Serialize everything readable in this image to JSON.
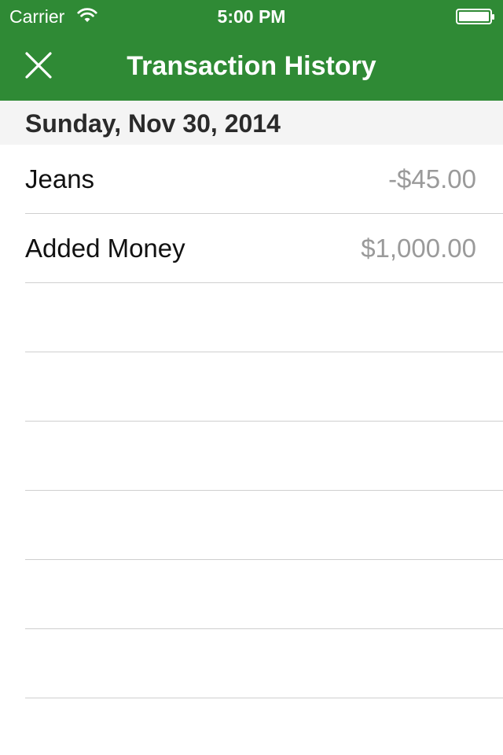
{
  "status_bar": {
    "carrier": "Carrier",
    "time": "5:00 PM",
    "wifi_icon": "wifi-icon",
    "battery_icon": "battery-icon"
  },
  "nav": {
    "title": "Transaction History",
    "close_icon": "close-icon",
    "background_color": "#2f8a35"
  },
  "section": {
    "date": "Sunday, Nov 30, 2014"
  },
  "transactions": [
    {
      "name": "Jeans",
      "amount": "-$45.00"
    },
    {
      "name": "Added Money",
      "amount": "$1,000.00"
    },
    {
      "name": "",
      "amount": ""
    },
    {
      "name": "",
      "amount": ""
    },
    {
      "name": "",
      "amount": ""
    },
    {
      "name": "",
      "amount": ""
    },
    {
      "name": "",
      "amount": ""
    },
    {
      "name": "",
      "amount": ""
    }
  ]
}
